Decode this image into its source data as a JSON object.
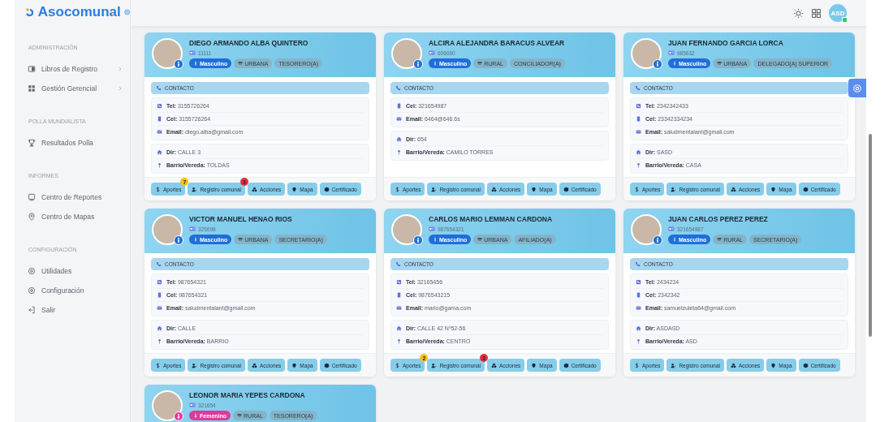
{
  "brand": {
    "name": "Asocomunal"
  },
  "sidebar": {
    "sections": [
      {
        "heading": "ADMINISTRACIÓN",
        "items": [
          {
            "label": "Libros de Registro",
            "kind": "book",
            "submenu": true
          },
          {
            "label": "Gestión Gerencial",
            "kind": "grid",
            "submenu": true
          }
        ]
      },
      {
        "heading": "POLLA MUNDIALISTA",
        "items": [
          {
            "label": "Resultados Polla",
            "kind": "trophy",
            "submenu": false
          }
        ]
      },
      {
        "heading": "INFORMES",
        "items": [
          {
            "label": "Centro de Reportes",
            "kind": "monitor",
            "submenu": false
          },
          {
            "label": "Centro de Mapas",
            "kind": "pin",
            "submenu": false
          }
        ]
      },
      {
        "heading": "CONFIGURACIÓN",
        "items": [
          {
            "label": "Utilidades",
            "kind": "gear",
            "submenu": false
          },
          {
            "label": "Configuración",
            "kind": "gear",
            "submenu": false
          },
          {
            "label": "Salir",
            "kind": "logout",
            "submenu": false
          }
        ]
      }
    ]
  },
  "header": {
    "avatar_initials": "ASD",
    "online": true
  },
  "cards": [
    {
      "name": "DIEGO ARMANDO ALBA QUINTERO",
      "id_number": "11111",
      "gender": {
        "label": "Masculino",
        "kind": "male"
      },
      "zone": "URBANA",
      "role": "TESORERO(A)",
      "contact_heading": "CONTACTO",
      "contact": [
        {
          "kind": "tel",
          "label": "Tel:",
          "value": "3155726264"
        },
        {
          "kind": "cel",
          "label": "Cel:",
          "value": "3155726264"
        },
        {
          "kind": "email",
          "label": "Email:",
          "value": "diego.alba@gmail.com"
        }
      ],
      "address": [
        {
          "kind": "dir",
          "label": "Dir:",
          "value": "CALLE 3"
        },
        {
          "kind": "barrio",
          "label": "Barrio/Vereda:",
          "value": "TOLDAS"
        }
      ],
      "actions": [
        {
          "kind": "aportes",
          "label": "Aportes",
          "badge": "7",
          "color": "#f5c21b"
        },
        {
          "kind": "registro",
          "label": "Registro comunal",
          "badge": "3",
          "color": "#e0323c"
        },
        {
          "kind": "acciones",
          "label": "Acciones"
        },
        {
          "kind": "mapa",
          "label": "Mapa"
        },
        {
          "kind": "certificado",
          "label": "Certificado"
        }
      ]
    },
    {
      "name": "ALCIRA ALEJANDRA BARACUS ALVEAR",
      "id_number": "606060",
      "gender": {
        "label": "Masculino",
        "kind": "male"
      },
      "zone": "RURAL",
      "role": "CONCILIADOR(A)",
      "contact_heading": "CONTACTO",
      "contact": [
        {
          "kind": "cel",
          "label": "Cel:",
          "value": "321654987"
        },
        {
          "kind": "email",
          "label": "Email:",
          "value": "6464@646.6s"
        }
      ],
      "address": [
        {
          "kind": "dir",
          "label": "Dir:",
          "value": "654"
        },
        {
          "kind": "barrio",
          "label": "Barrio/Vereda:",
          "value": "CAMILO TORRES"
        }
      ],
      "actions": [
        {
          "kind": "aportes",
          "label": "Aportes"
        },
        {
          "kind": "registro",
          "label": "Registro comunal"
        },
        {
          "kind": "acciones",
          "label": "Acciones"
        },
        {
          "kind": "mapa",
          "label": "Mapa"
        },
        {
          "kind": "certificado",
          "label": "Certificado"
        }
      ]
    },
    {
      "name": "JUAN FERNANDO GARCIA LORCA",
      "id_number": "985632",
      "gender": {
        "label": "Masculino",
        "kind": "male"
      },
      "zone": "URBANA",
      "role": "DELEGADO(A) SUPERIOR",
      "contact_heading": "CONTACTO",
      "contact": [
        {
          "kind": "tel",
          "label": "Tel:",
          "value": "2342342433"
        },
        {
          "kind": "cel",
          "label": "Cel:",
          "value": "23342334234"
        },
        {
          "kind": "email",
          "label": "Email:",
          "value": "saludmentalant@gmail.com"
        }
      ],
      "address": [
        {
          "kind": "dir",
          "label": "Dir:",
          "value": "SASD"
        },
        {
          "kind": "barrio",
          "label": "Barrio/Vereda:",
          "value": "CASA"
        }
      ],
      "actions": [
        {
          "kind": "aportes",
          "label": "Aportes"
        },
        {
          "kind": "registro",
          "label": "Registro comunal"
        },
        {
          "kind": "acciones",
          "label": "Acciones"
        },
        {
          "kind": "mapa",
          "label": "Mapa"
        },
        {
          "kind": "certificado",
          "label": "Certificado"
        }
      ]
    },
    {
      "name": "VICTOR MANUEL HENAO RIOS",
      "id_number": "325698",
      "gender": {
        "label": "Masculino",
        "kind": "male"
      },
      "zone": "URBANA",
      "role": "SECRETARIO(A)",
      "contact_heading": "CONTACTO",
      "contact": [
        {
          "kind": "tel",
          "label": "Tel:",
          "value": "987654321"
        },
        {
          "kind": "cel",
          "label": "Cel:",
          "value": "987654321"
        },
        {
          "kind": "email",
          "label": "Email:",
          "value": "saludmentalant@gmail.com"
        }
      ],
      "address": [
        {
          "kind": "dir",
          "label": "Dir:",
          "value": "CALLE"
        },
        {
          "kind": "barrio",
          "label": "Barrio/Vereda:",
          "value": "BARRIO"
        }
      ],
      "actions": [
        {
          "kind": "aportes",
          "label": "Aportes"
        },
        {
          "kind": "registro",
          "label": "Registro comunal"
        },
        {
          "kind": "acciones",
          "label": "Acciones"
        },
        {
          "kind": "mapa",
          "label": "Mapa"
        },
        {
          "kind": "certificado",
          "label": "Certificado"
        }
      ]
    },
    {
      "name": "CARLOS MARIO LEMMAN CARDONA",
      "id_number": "987654321",
      "gender": {
        "label": "Masculino",
        "kind": "male"
      },
      "zone": "URBANA",
      "role": "AFILIADO(A)",
      "contact_heading": "CONTACTO",
      "contact": [
        {
          "kind": "tel",
          "label": "Tel:",
          "value": "32165456"
        },
        {
          "kind": "cel",
          "label": "Cel:",
          "value": "9876543215"
        },
        {
          "kind": "email",
          "label": "Email:",
          "value": "mario@gama.com"
        }
      ],
      "address": [
        {
          "kind": "dir",
          "label": "Dir:",
          "value": "CALLE 42 Nº52-56"
        },
        {
          "kind": "barrio",
          "label": "Barrio/Vereda:",
          "value": "CENTRO"
        }
      ],
      "actions": [
        {
          "kind": "aportes",
          "label": "Aportes",
          "badge": "2",
          "color": "#f5c21b"
        },
        {
          "kind": "registro",
          "label": "Registro comunal",
          "badge": "3",
          "color": "#e0323c"
        },
        {
          "kind": "acciones",
          "label": "Acciones"
        },
        {
          "kind": "mapa",
          "label": "Mapa"
        },
        {
          "kind": "certificado",
          "label": "Certificado"
        }
      ]
    },
    {
      "name": "JUAN CARLOS PEREZ PEREZ",
      "id_number": "321654987",
      "gender": {
        "label": "Masculino",
        "kind": "male"
      },
      "zone": "RURAL",
      "role": "SECRETARIO(A)",
      "contact_heading": "CONTACTO",
      "contact": [
        {
          "kind": "tel",
          "label": "Tel:",
          "value": "2434234"
        },
        {
          "kind": "cel",
          "label": "Cel:",
          "value": "2342342"
        },
        {
          "kind": "email",
          "label": "Email:",
          "value": "samuelzuleta64@gmail.com"
        }
      ],
      "address": [
        {
          "kind": "dir",
          "label": "Dir:",
          "value": "ASDASD"
        },
        {
          "kind": "barrio",
          "label": "Barrio/Vereda:",
          "value": "ASD"
        }
      ],
      "actions": [
        {
          "kind": "aportes",
          "label": "Aportes"
        },
        {
          "kind": "registro",
          "label": "Registro comunal"
        },
        {
          "kind": "acciones",
          "label": "Acciones"
        },
        {
          "kind": "mapa",
          "label": "Mapa"
        },
        {
          "kind": "certificado",
          "label": "Certificado"
        }
      ]
    },
    {
      "name": "LEONOR MARIA YEPES CARDONA",
      "id_number": "321654",
      "gender": {
        "label": "Femenino",
        "kind": "female"
      },
      "zone": "RURAL",
      "role": "TESORERO(A)"
    }
  ]
}
